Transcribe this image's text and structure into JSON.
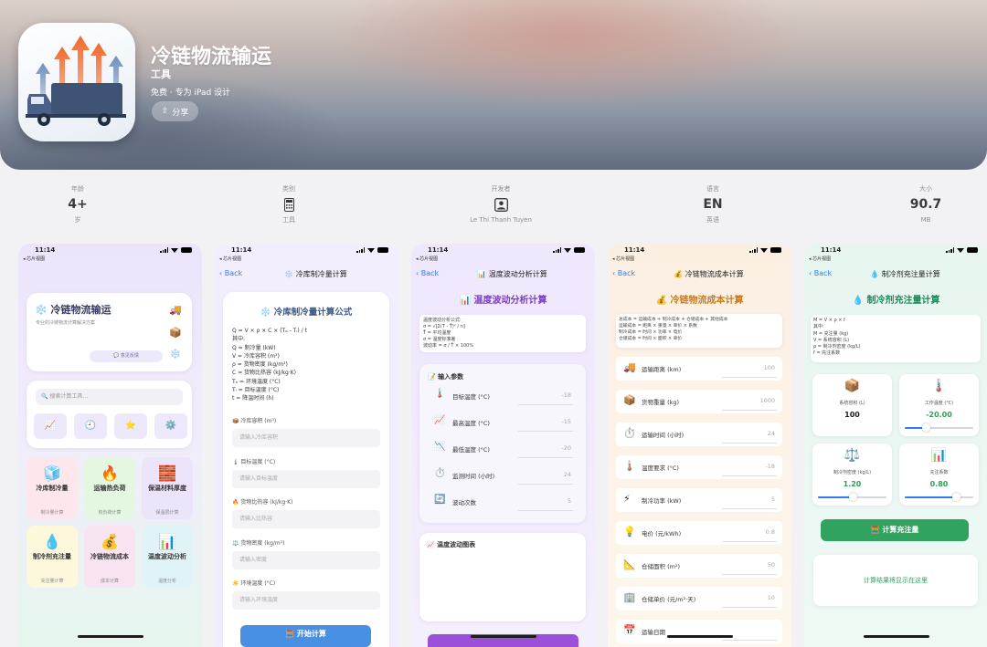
{
  "app": {
    "name": "冷链物流输运",
    "category": "工具",
    "subtitle": "免费 · 专为 iPad 设计",
    "share_label": "分享"
  },
  "info": [
    {
      "label": "年龄",
      "value": "4+",
      "sub": "岁"
    },
    {
      "label": "类别",
      "icon": "calculator-icon",
      "sub": "工具"
    },
    {
      "label": "开发者",
      "icon": "person-icon",
      "sub": "Le Thi Thanh Tuyen"
    },
    {
      "label": "语言",
      "value": "EN",
      "sub": "英语"
    },
    {
      "label": "大小",
      "value": "90.7",
      "sub": "MB"
    }
  ],
  "status": {
    "time": "11:14",
    "back_app": "◂ 芯片视图"
  },
  "screen1": {
    "title": "冷链物流输运",
    "subtitle": "专业的冷链物流计算解决方案",
    "feedback": "意见反馈",
    "search_placeholder": "🔍 搜索计算工具...",
    "tiles": [
      {
        "icon": "🧊",
        "title": "冷库制冷量",
        "sub": "制冷量计算",
        "bg": "#fde7ec"
      },
      {
        "icon": "🔥",
        "title": "运输热负荷",
        "sub": "热负荷计算",
        "bg": "#e3f7e1"
      },
      {
        "icon": "🧱",
        "title": "保温材料厚度",
        "sub": "保温层计算",
        "bg": "#ece4fb"
      },
      {
        "icon": "💧",
        "title": "制冷剂充注量",
        "sub": "充注量计算",
        "bg": "#fdf7dc"
      },
      {
        "icon": "💰",
        "title": "冷链物流成本",
        "sub": "成本计算",
        "bg": "#f8e3f1"
      },
      {
        "icon": "📊",
        "title": "温度波动分析",
        "sub": "温度分析",
        "bg": "#e0f4f8"
      }
    ]
  },
  "screen2": {
    "back": "Back",
    "nav_title": "❄️ 冷库制冷量计算",
    "heading": "❄️ 冷库制冷量计算公式",
    "formula": [
      "Q = V × ρ × C × (Tₒ - Tᵢ) / t",
      "其中:",
      "Q = 制冷量 (kW)",
      "V = 冷库容积 (m³)",
      "ρ = 货物密度 (kg/m³)",
      "C = 货物比热容 (kJ/kg·K)",
      "Tₒ = 环境温度 (°C)",
      "Tᵢ = 目标温度 (°C)",
      "t = 降温时间 (h)"
    ],
    "fields": [
      {
        "label": "📦 冷库容积 (m³)",
        "placeholder": "请输入冷库容积"
      },
      {
        "label": "🌡️ 目标温度 (°C)",
        "placeholder": "请输入目标温度"
      },
      {
        "label": "🔥 货物比热容 (kJ/kg·K)",
        "placeholder": "请输入比热容"
      },
      {
        "label": "⚖️ 货物密度 (kg/m³)",
        "placeholder": "请输入密度"
      },
      {
        "label": "☀️ 环境温度 (°C)",
        "placeholder": "请输入环境温度"
      }
    ],
    "button": "🧮 开始计算"
  },
  "screen3": {
    "back": "Back",
    "nav_title": "📊 温度波动分析计算",
    "heading": "📊 温度波动分析计算",
    "formula": [
      "温度波动分析公式:",
      "σ = √[Σ(T - T̄)² / n]",
      "T̄ = 平均温度",
      "σ = 温度标准差",
      "波动率 = σ / T̄ × 100%"
    ],
    "section": "📝 输入参数",
    "rows": [
      {
        "icon": "🌡️",
        "label": "目标温度 (°C)",
        "value": "-18"
      },
      {
        "icon": "📈",
        "label": "最高温度 (°C)",
        "value": "-15"
      },
      {
        "icon": "📉",
        "label": "最低温度 (°C)",
        "value": "-20"
      },
      {
        "icon": "⏱️",
        "label": "监测时间 (小时)",
        "value": "24"
      },
      {
        "icon": "🔄",
        "label": "波动次数",
        "value": "5"
      }
    ],
    "chart_title": "📈 温度波动图表"
  },
  "screen4": {
    "back": "Back",
    "nav_title": "💰 冷链物流成本计算",
    "heading": "💰 冷链物流成本计算",
    "formula": [
      "总成本 = 运输成本 + 制冷成本 + 仓储成本 + 其他成本",
      "运输成本 = 距离 × 重量 × 单价 × 系数",
      "制冷成本 = 时间 × 功率 × 电价",
      "仓储成本 = 时间 × 面积 × 单价"
    ],
    "rows": [
      {
        "icon": "🚚",
        "label": "运输距离 (km)",
        "value": "100"
      },
      {
        "icon": "📦",
        "label": "货物重量 (kg)",
        "value": "1000"
      },
      {
        "icon": "⏱️",
        "label": "运输时间 (小时)",
        "value": "24"
      },
      {
        "icon": "🌡️",
        "label": "温度要求 (°C)",
        "value": "-18"
      },
      {
        "icon": "⚡",
        "label": "制冷功率 (kW)",
        "value": "5"
      },
      {
        "icon": "💡",
        "label": "电价 (元/kWh)",
        "value": "0.8"
      },
      {
        "icon": "📐",
        "label": "仓储面积 (m²)",
        "value": "50"
      },
      {
        "icon": "🏢",
        "label": "仓储单价 (元/m²·天)",
        "value": "10"
      },
      {
        "icon": "📅",
        "label": "运输日期",
        "value": ""
      }
    ]
  },
  "screen5": {
    "back": "Back",
    "nav_title": "💧 制冷剂充注量计算",
    "heading": "💧 制冷剂充注量计算",
    "formula": [
      "M = V × ρ × f",
      "其中:",
      "M = 充注量 (kg)",
      "V = 系统容积 (L)",
      "ρ = 制冷剂密度 (kg/L)",
      "f = 充注系数"
    ],
    "cells": [
      {
        "icon": "📦",
        "label": "系统容积 (L)",
        "value": "100",
        "color": "#1c1c1e",
        "slider": false
      },
      {
        "icon": "🌡️",
        "label": "工作温度 (°C)",
        "value": "-20.00",
        "color": "#2f9e55",
        "slider": true,
        "level": 0.3
      },
      {
        "icon": "⚖️",
        "label": "制冷剂密度 (kg/L)",
        "value": "1.20",
        "color": "#2f9e55",
        "slider": true,
        "level": 0.5
      },
      {
        "icon": "📊",
        "label": "充注系数",
        "value": "0.80",
        "color": "#2f9e55",
        "slider": true,
        "level": 0.75
      }
    ],
    "button": "🧮 计算充注量",
    "result_placeholder": "计算结果将显示在这里"
  }
}
